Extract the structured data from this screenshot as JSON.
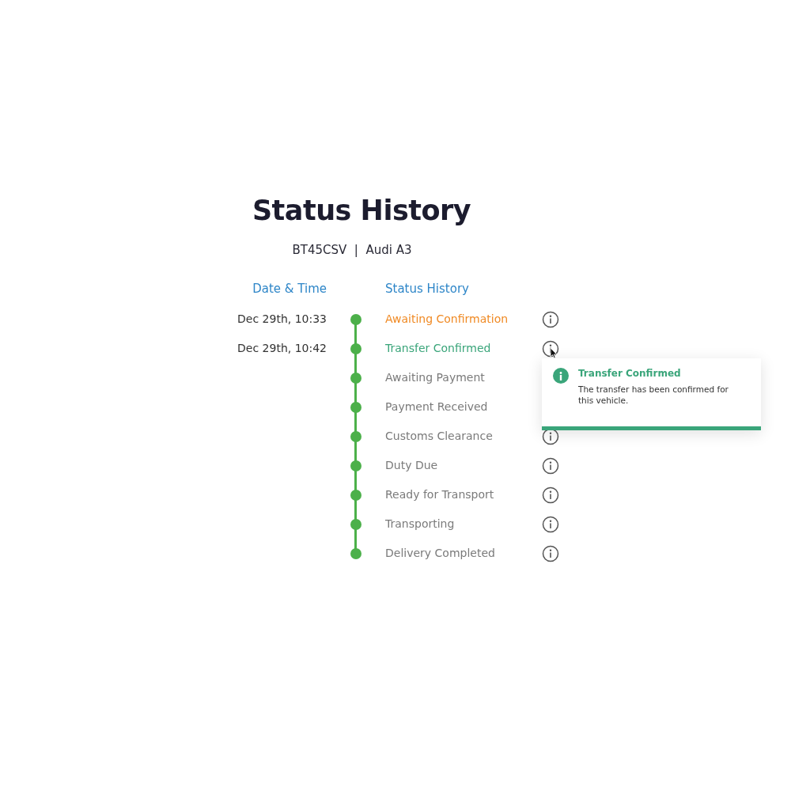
{
  "title": "Status History",
  "vehicle": "BT45CSV  |  Audi A3",
  "columns": [
    "Date & Time",
    "Status History"
  ],
  "rows": [
    {
      "date": "Dec 29th, 10:33",
      "status": "Awaiting Confirmation",
      "kind": "current"
    },
    {
      "date": "Dec 29th, 10:42",
      "status": "Transfer Confirmed",
      "kind": "done",
      "tooltip": {
        "title": "Transfer Confirmed",
        "text": "The transfer has been confirmed for this vehicle."
      }
    },
    {
      "status": "Awaiting Payment",
      "kind": "upcoming"
    },
    {
      "status": "Payment Received",
      "kind": "upcoming"
    },
    {
      "status": "Customs Clearance",
      "kind": "upcoming"
    },
    {
      "status": "Duty Due",
      "kind": "upcoming"
    },
    {
      "status": "Ready for Transport",
      "kind": "upcoming"
    },
    {
      "status": "Transporting",
      "kind": "upcoming"
    },
    {
      "status": "Delivery Completed",
      "kind": "upcoming"
    }
  ]
}
